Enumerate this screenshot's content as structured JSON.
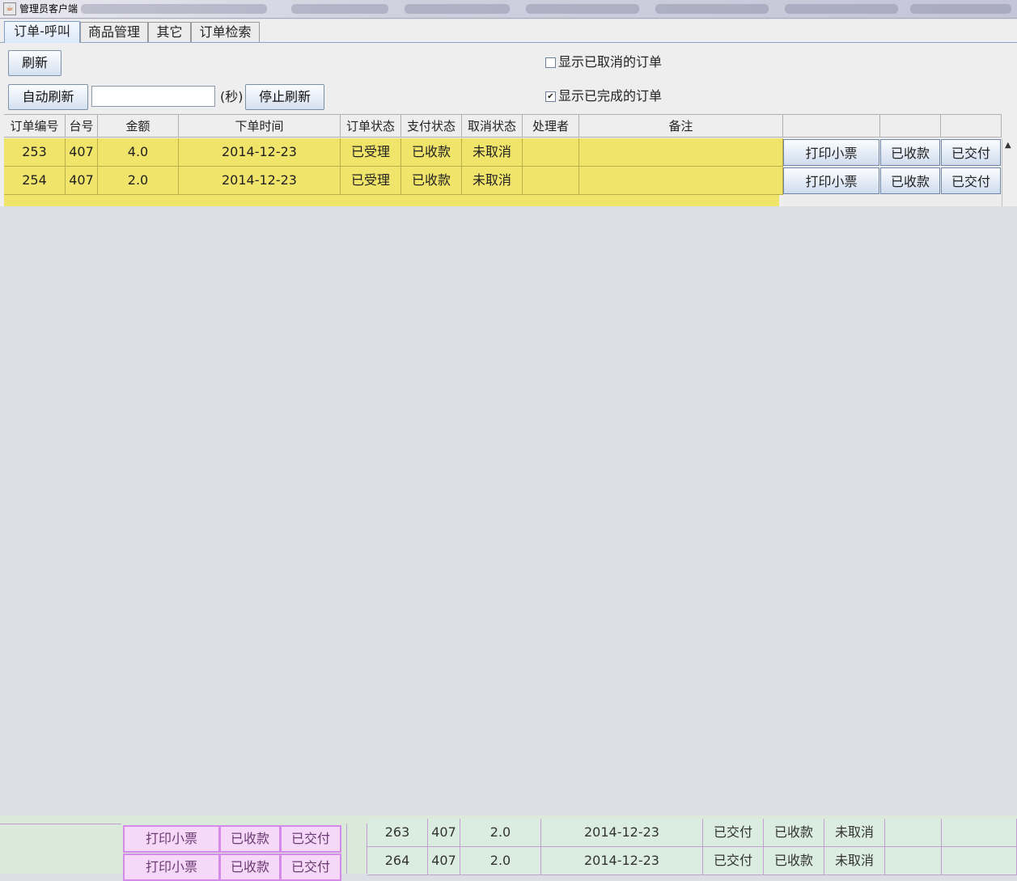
{
  "window": {
    "title": "管理员客户端"
  },
  "tabs": [
    "订单-呼叫",
    "商品管理",
    "其它",
    "订单检索"
  ],
  "toolbar": {
    "refresh_label": "刷新",
    "auto_refresh_label": "自动刷新",
    "interval_value": "",
    "seconds_label": "(秒)",
    "stop_refresh_label": "停止刷新",
    "show_cancelled_label": "显示已取消的订单",
    "show_cancelled_checked": false,
    "show_completed_label": "显示已完成的订单",
    "show_completed_checked": true
  },
  "table": {
    "headers": [
      "订单编号",
      "台号",
      "金额",
      "下单时间",
      "订单状态",
      "支付状态",
      "取消状态",
      "处理者",
      "备注",
      "",
      "",
      ""
    ],
    "rows": [
      {
        "id": "253",
        "table_no": "407",
        "amount": "4.0",
        "time": "2014-12-23",
        "order_status": "已受理",
        "pay_status": "已收款",
        "cancel_status": "未取消",
        "handler": "",
        "note": "",
        "print": "打印小票",
        "paid": "已收款",
        "delivered": "已交付"
      },
      {
        "id": "254",
        "table_no": "407",
        "amount": "2.0",
        "time": "2014-12-23",
        "order_status": "已受理",
        "pay_status": "已收款",
        "cancel_status": "未取消",
        "handler": "",
        "note": "",
        "print": "打印小票",
        "paid": "已收款",
        "delivered": "已交付"
      }
    ]
  },
  "bottom_fragment": {
    "buttons": [
      {
        "print": "打印小票",
        "paid": "已收款",
        "delivered": "已交付"
      },
      {
        "print": "打印小票",
        "paid": "已收款",
        "delivered": "已交付"
      }
    ],
    "rows": [
      {
        "id": "263",
        "table_no": "407",
        "amount": "2.0",
        "time": "2014-12-23",
        "order_status": "已交付",
        "pay_status": "已收款",
        "cancel_status": "未取消"
      },
      {
        "id": "264",
        "table_no": "407",
        "amount": "2.0",
        "time": "2014-12-23",
        "order_status": "已交付",
        "pay_status": "已收款",
        "cancel_status": "未取消"
      }
    ]
  }
}
